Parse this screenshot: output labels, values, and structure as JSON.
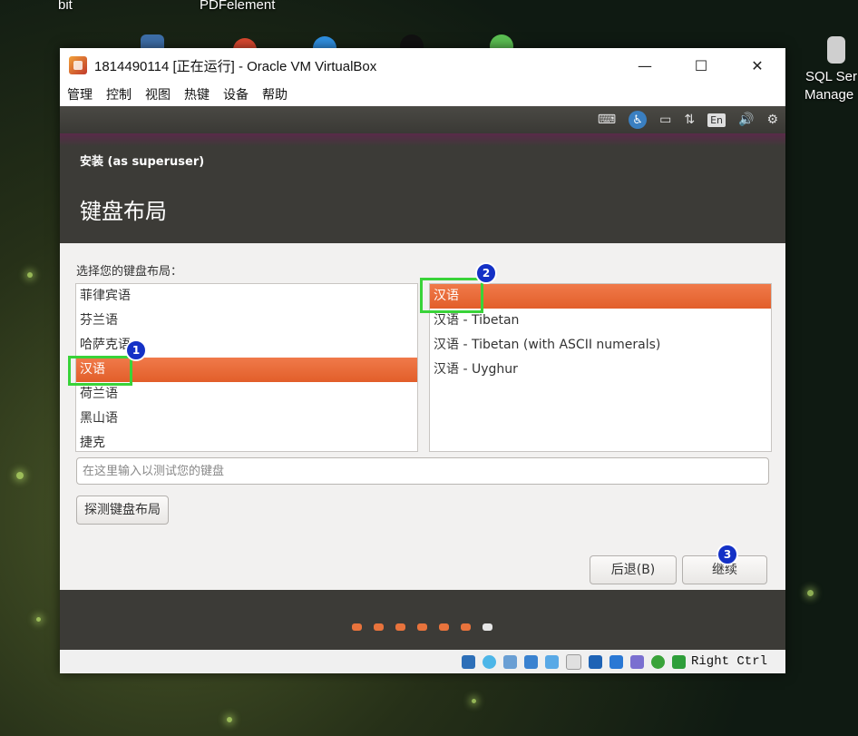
{
  "desktop": {
    "labels": [
      "bit",
      "PDFelement",
      "SQL Ser",
      "Manage"
    ]
  },
  "window": {
    "title": "1814490114 [正在运行] - Oracle VM VirtualBox",
    "minimize": "—",
    "maximize": "☐",
    "close": "✕"
  },
  "menu": [
    "管理",
    "控制",
    "视图",
    "热键",
    "设备",
    "帮助"
  ],
  "guest_topbar": {
    "keyboard": "⌨",
    "accessibility": "♿",
    "battery": "▭",
    "network": "⇅",
    "language": "En",
    "volume": "🔊",
    "settings": "⚙"
  },
  "installer": {
    "subtitle": "安装 (as superuser)",
    "title": "键盘布局",
    "choose_label": "选择您的键盘布局：",
    "layouts": [
      "菲律宾语",
      "芬兰语",
      "哈萨克语",
      "汉语",
      "荷兰语",
      "黑山语",
      "捷克"
    ],
    "selected_layout_index": 3,
    "variants": [
      "汉语",
      "汉语 - Tibetan",
      "汉语 - Tibetan (with ASCII numerals)",
      "汉语 - Uyghur"
    ],
    "selected_variant_index": 0,
    "test_placeholder": "在这里输入以测试您的键盘",
    "detect_button": "探测键盘布局",
    "back_button": "后退(B)",
    "continue_button": "继续",
    "progress_total": 7,
    "progress_current": 7
  },
  "annotations": {
    "marker1": "1",
    "marker2": "2",
    "marker3": "3"
  },
  "statusbar": {
    "host_key": "Right Ctrl"
  },
  "colors": {
    "selection": "#e25e2a",
    "highlight": "#39d339",
    "marker": "#1431c6",
    "guest_bg": "#3c3b37"
  }
}
